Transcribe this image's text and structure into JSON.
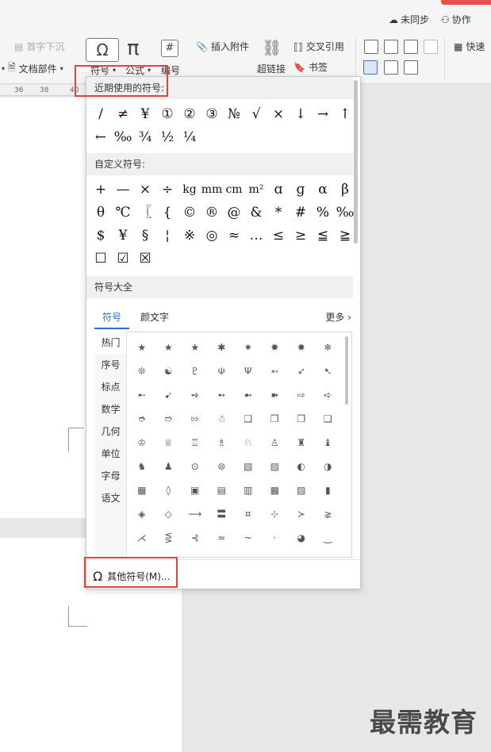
{
  "topbar": {
    "sync": "未同步",
    "collab": "协作"
  },
  "ribbon": {
    "first_char_sink": "首字下沉",
    "doc_parts": "文档部件",
    "symbol": "符号",
    "formula": "公式",
    "numbering": "编号",
    "insert_attachment": "插入附件",
    "hyperlink": "超链接",
    "cross_ref": "交叉引用",
    "bookmark": "书签",
    "quick": "快速"
  },
  "ruler": {
    "ticks": [
      "36",
      "38",
      "40"
    ]
  },
  "panel": {
    "recent_title": "近期使用的符号:",
    "recent_symbols": [
      "/",
      "≠",
      "¥",
      "①",
      "②",
      "③",
      "№",
      "√",
      "×",
      "↓",
      "→",
      "↑",
      "←",
      "‰",
      "¾",
      "½",
      "¼"
    ],
    "custom_title": "自定义符号:",
    "custom_symbols": [
      "+",
      "—",
      "×",
      "÷",
      "kg",
      "mm",
      "cm",
      "m²",
      "ɑ",
      "ɡ",
      "α",
      "β",
      "θ",
      "℃",
      "〖",
      "{",
      "©",
      "®",
      "@",
      "&",
      "*",
      "#",
      "%",
      "‰",
      "$",
      "¥",
      "§",
      "¦",
      "※",
      "◎",
      "≈",
      "…",
      "≤",
      "≥",
      "≦",
      "≧",
      "☐",
      "☑",
      "☒"
    ],
    "all_title": "符号大全",
    "tabs": {
      "symbol": "符号",
      "emoticon": "颜文字",
      "more": "更多"
    },
    "categories": [
      "热门",
      "序号",
      "标点",
      "数学",
      "几何",
      "单位",
      "字母",
      "语文"
    ],
    "grid_symbols": [
      "★",
      "★",
      "★",
      "✱",
      "✷",
      "✸",
      "✹",
      "❄",
      "❊",
      "☯",
      "♇",
      "☫",
      "Ψ",
      "➵",
      "➶",
      "➷",
      "➸",
      "➹",
      "➺",
      "➻",
      "➼",
      "➽",
      "⇨",
      "➪",
      "➮",
      "➱",
      "⇰",
      "☃",
      "❑",
      "❒",
      "❐",
      "❏",
      "♔",
      "♕",
      "♖",
      "♗",
      "♘",
      "♙",
      "♜",
      "♝",
      "♞",
      "♟",
      "⊙",
      "⊚",
      "▧",
      "▨",
      "◐",
      "◑",
      "▦",
      "◊",
      "▣",
      "▤",
      "▥",
      "▩",
      "▨",
      "▮",
      "◈",
      "◇",
      "⟶",
      "〓",
      "¤",
      "⊹",
      "≻",
      "⋧",
      "⋌",
      "⋚",
      "⊰",
      "≈",
      "~",
      "·",
      "◕",
      "‿"
    ],
    "other_symbols_button": "其他符号(M)..."
  },
  "watermark": "最需教育",
  "colors": {
    "accent": "#2b6ed3",
    "highlight": "#e54141"
  }
}
